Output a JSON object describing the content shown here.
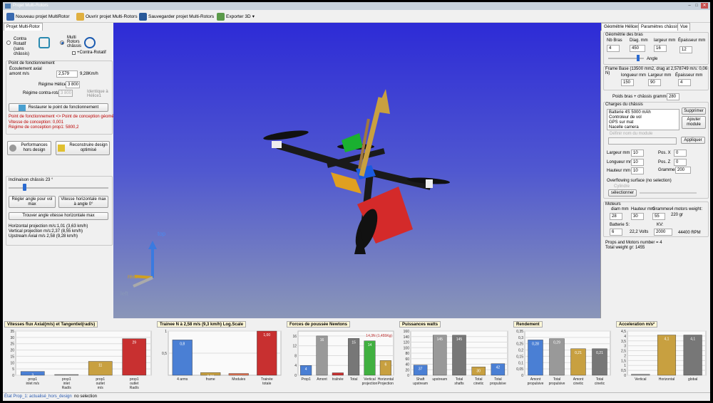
{
  "window": {
    "title": "Projet Multi-Rotors"
  },
  "toolbar": {
    "items": [
      "Nouveau projet MultiRotor",
      "Ouvrir projet Multi-Rotors",
      "Sauvegarder projet Multi-Rotors",
      "Exporter 3D"
    ]
  },
  "left": {
    "tab": "Projet Multi-Rotor",
    "mode1": "Contra Rotatif (sans châssis)",
    "mode2": "Multi Rotors châssis",
    "contra_check": "+Contra-Rotatif",
    "group_title": "Point de fonctionnement",
    "flow_label": "Écoulement axial amont m/s",
    "flow_value": "2,579",
    "flow_kmh": "9,28Km/h",
    "regime1_label": "Régime Hélice1",
    "regime1_value": "3 800",
    "regime2_label": "Régime contra-rotatif",
    "regime2_value": "3 800",
    "identical": "Identique à Hélice1",
    "restore_btn": "Restaurer le point de fonctionnement",
    "warn1": "Point de fonctionnement <> Point de conception géométrie",
    "warn2": "Vitesse de conception: 0,001",
    "warn3": "Régime de conception prop1: 5800,2",
    "perf_btn": "Performances hors design",
    "recon_btn": "Reconstruire design optimisé",
    "incl": "Inclinaison châssis 23 °",
    "btn_angle": "Régler angle pour vol max",
    "btn_vmax": "Vitesse horizontale max à angle 0°",
    "btn_find": "Trouver angle vitesse horizontale max",
    "proj1": "Horizontal projection m/s:1,01 (3,63 km/h)",
    "proj2": "Vertical projection m/s:2,37 (8,55 km/h)",
    "proj3": "Upstream Axial m/s 2,58 (9,28 km/h)"
  },
  "view": {
    "axis_top": "top",
    "axis_rear": "rear",
    "axis_left": "left"
  },
  "right": {
    "tabs": [
      "Géométrie Hélices",
      "Paramètres châssis",
      "Vue"
    ],
    "arm_title": "Géométrie des bras",
    "arm_heads": [
      "Nb Bras",
      "Diag. mm",
      "largeur mm",
      "Épaisseur mm"
    ],
    "arm_vals": [
      "4",
      "450",
      "16",
      "12"
    ],
    "angle": "Angle",
    "frame_title": "Frame Base (13500 mm2, drag at 2,578749 m/s: 0,06 N)",
    "frame_heads": [
      "longueur mm",
      "Largeur mm",
      "Épaisseur mm"
    ],
    "frame_vals": [
      "150",
      "90",
      "4"
    ],
    "weight_label": "Poids bras + châssis grammes",
    "weight_val": "280",
    "charges_title": "Charges du châssis",
    "charges": [
      "Batterie 4S 5000 mAh",
      "Controleur de vol",
      "GPS sur mat",
      "Nacelle camera"
    ],
    "delete_btn": "Supprimer",
    "add_btn": "Ajouter module",
    "module_label": "Définir nom du module",
    "apply_btn": "Appliquer",
    "dims": [
      {
        "l": "Largeur mm",
        "v": "10"
      },
      {
        "l": "Longueur mm",
        "v": "10"
      },
      {
        "l": "Hauteur mm",
        "v": "10"
      }
    ],
    "pos": [
      {
        "l": "Pos. X",
        "v": "0"
      },
      {
        "l": "Pos. Z",
        "v": "0"
      },
      {
        "l": "Grammes",
        "v": "200"
      }
    ],
    "overflow": "Overflowing surface (no selection)",
    "cylinder": "Cylindre",
    "select_btn": "sélectionner",
    "motors_title": "Moteurs",
    "motor_heads": [
      "diam mm",
      "Hauteur mm",
      "Grammes",
      "4 motors weight:"
    ],
    "motor_vals": [
      "28",
      "30",
      "55"
    ],
    "motor_weight": "220 gr",
    "battery_label": "Batterie S:",
    "battery_val": "6",
    "volts": "22,2 Volts",
    "kv_label": "KV:",
    "kv_val": "2000",
    "rpm": "44400 RPM",
    "props_count": "Props and Motors number = 4",
    "total_weight": "Total weight gr: 1455"
  },
  "status": {
    "state": "État Prop_1: actualisé_hors_design",
    "sel": "no selection"
  },
  "chart_data": [
    {
      "type": "bar",
      "title": "Vitesses flux Axial(m/s) et Tangentiel(rad/s)",
      "categories": [
        "prop1 inlet m/s",
        "prop1 inlet Rad/s",
        "prop1 outlet m/s",
        "prop1 outlet Rad/s"
      ],
      "values": [
        3,
        0,
        11,
        29
      ],
      "labels": [
        "3",
        "0",
        "11",
        "29"
      ],
      "ylim": [
        0,
        35
      ],
      "ticks": [
        0,
        5,
        10,
        15,
        20,
        25,
        30,
        35
      ],
      "colors": [
        "#4a7fd4",
        "#999999",
        "#c8a040",
        "#c83030"
      ]
    },
    {
      "type": "bar",
      "title": "Trainee N à 2,58 m/s (9,3 km/h) Log.Scale",
      "categories": [
        "4 arms",
        "frame",
        "Modules",
        "Trainée totale"
      ],
      "values": [
        0.8,
        0.06,
        0.04,
        1
      ],
      "labels": [
        "0,8",
        "0,06",
        "0,04",
        "1,00"
      ],
      "ylim": [
        0,
        1
      ],
      "ticks": [
        0.5,
        1,
        1.5
      ],
      "colors": [
        "#4a7fd4",
        "#c8a040",
        "#e07050",
        "#c83030"
      ]
    },
    {
      "type": "bar",
      "title": "Forces de poussée Newtons",
      "categories": [
        "Prop1",
        "Amont",
        "traînée",
        "Total",
        "Vertical projection",
        "Horizontal Projection"
      ],
      "values": [
        4,
        16,
        1,
        15,
        14,
        6
      ],
      "labels": [
        "4",
        "16",
        "",
        "15",
        "14",
        "6"
      ],
      "ylim": [
        0,
        18
      ],
      "ticks": [
        0,
        4,
        8,
        12,
        16
      ],
      "annotation": "14,3N (1,455Kg)",
      "colors": [
        "#4a7fd4",
        "#999999",
        "#c83030",
        "#777777",
        "#40b040",
        "#c8a040"
      ]
    },
    {
      "type": "bar",
      "title": "Puissances watts",
      "categories": [
        "Shaft upstream",
        "upstream",
        "Total shafts",
        "Total cinetic",
        "Total propulsive"
      ],
      "values": [
        37,
        145,
        145,
        30,
        42
      ],
      "labels": [
        "37",
        "145",
        "145",
        "30",
        "42"
      ],
      "ylim": [
        0,
        160
      ],
      "ticks": [
        0,
        20,
        40,
        60,
        80,
        100,
        120,
        140,
        160
      ],
      "colors": [
        "#4a7fd4",
        "#999999",
        "#777777",
        "#c8a040",
        "#4a7fd4"
      ]
    },
    {
      "type": "bar",
      "title": "Rendement",
      "categories": [
        "Amont propulsive",
        "Total propulsive",
        "Amont cinetic",
        "Total cinetic"
      ],
      "values": [
        0.28,
        0.29,
        0.21,
        0.21
      ],
      "labels": [
        "0,28",
        "0,29",
        "0,21",
        "0,21"
      ],
      "ylim": [
        0,
        0.35
      ],
      "ticks": [
        0,
        0.05,
        0.1,
        0.15,
        0.2,
        0.25,
        0.3,
        0.35
      ],
      "colors": [
        "#4a7fd4",
        "#999999",
        "#c8a040",
        "#777777"
      ]
    },
    {
      "type": "bar",
      "title": "Acceleration m/s²",
      "categories": [
        "Vertical",
        "Horizontal",
        "global"
      ],
      "values": [
        0.1,
        4.1,
        4.1
      ],
      "labels": [
        "0,1",
        "4,1",
        "4,1"
      ],
      "ylim": [
        0,
        4.5
      ],
      "ticks": [
        0,
        0.5,
        1,
        1.5,
        2,
        2.5,
        3,
        3.5,
        4,
        4.5
      ],
      "colors": [
        "#999999",
        "#c8a040",
        "#777777"
      ]
    }
  ]
}
